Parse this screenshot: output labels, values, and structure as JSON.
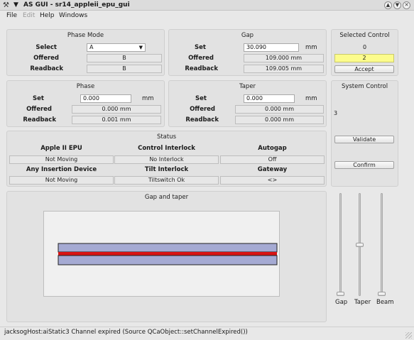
{
  "window": {
    "title": "AS GUI - sr14_appleii_epu_gui",
    "app_icon": "x-tools-icon",
    "controls": [
      "⌃",
      "⌄",
      "✕"
    ]
  },
  "menu": {
    "file": "File",
    "edit": "Edit",
    "help": "Help",
    "windows": "Windows"
  },
  "phase_mode": {
    "title": "Phase Mode",
    "select_label": "Select",
    "select_value": "A",
    "offered_label": "Offered",
    "offered_value": "B",
    "readback_label": "Readback",
    "readback_value": "B"
  },
  "gap": {
    "title": "Gap",
    "set_label": "Set",
    "set_value": "30.090",
    "set_unit": "mm",
    "offered_label": "Offered",
    "offered_value": "109.000 mm",
    "readback_label": "Readback",
    "readback_value": "109.005 mm"
  },
  "selected_control": {
    "title": "Selected Control",
    "value_top": "0",
    "value_box": "2",
    "accept_label": "Accept",
    "highlight_color": "#fcfc8c"
  },
  "phase": {
    "title": "Phase",
    "set_label": "Set",
    "set_value": "0.000",
    "set_unit": "mm",
    "offered_label": "Offered",
    "offered_value": "0.000 mm",
    "readback_label": "Readback",
    "readback_value": "0.001 mm"
  },
  "taper": {
    "title": "Taper",
    "set_label": "Set",
    "set_value": "0.000",
    "set_unit": "mm",
    "offered_label": "Offered",
    "offered_value": "0.000 mm",
    "readback_label": "Readback",
    "readback_value": "0.000 mm"
  },
  "system_control": {
    "title": "System Control",
    "value": "3",
    "validate_label": "Validate",
    "confirm_label": "Confirm"
  },
  "status": {
    "title": "Status",
    "apple_epu_label": "Apple II EPU",
    "apple_epu_value": "Not Moving",
    "control_interlock_label": "Control Interlock",
    "control_interlock_value": "No Interlock",
    "autogap_label": "Autogap",
    "autogap_value": "Off",
    "insertion_label": "Any Insertion Device",
    "insertion_value": "Not Moving",
    "tilt_label": "Tilt Interlock",
    "tilt_value": "Tiltswitch Ok",
    "gateway_label": "Gateway",
    "gateway_value": "<>"
  },
  "gap_taper_plot": {
    "title": "Gap and taper",
    "jaw_color": "#a5aad3",
    "beam_color": "#d81414"
  },
  "sliders": {
    "gap_label": "Gap",
    "taper_label": "Taper",
    "beam_label": "Beam",
    "gap_level": 0.0,
    "taper_level": 0.5,
    "beam_level": 0.0
  },
  "statusbar": {
    "message": "jacksogHost:aiStatic3 Channel expired (Source QCaObject::setChannelExpired())"
  }
}
